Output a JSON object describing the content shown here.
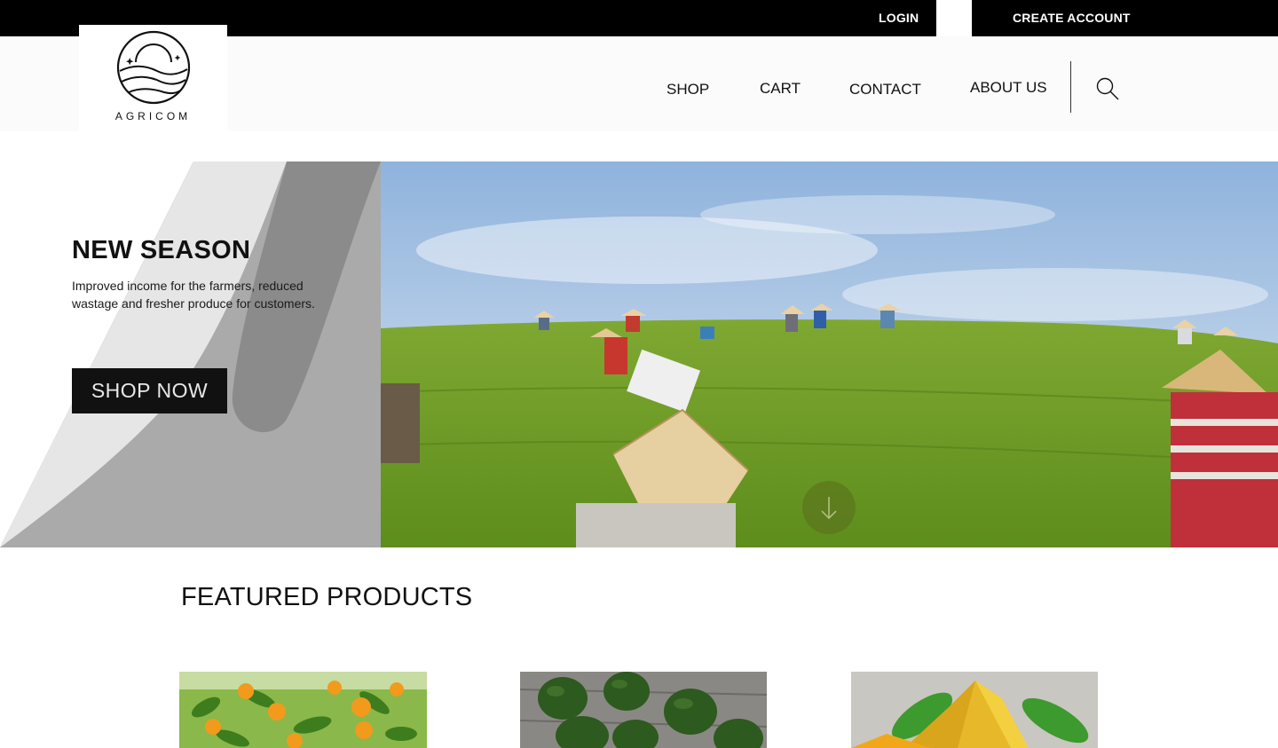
{
  "topbar": {
    "login_label": "LOGIN",
    "create_account_label": "CREATE ACCOUNT"
  },
  "brand": {
    "name": "AGRICOM"
  },
  "nav": {
    "items": [
      {
        "label": "SHOP"
      },
      {
        "label": "CART"
      },
      {
        "label": "CONTACT"
      },
      {
        "label": "ABOUT US"
      }
    ],
    "search_icon": "search-icon"
  },
  "hero": {
    "title": "NEW SEASON",
    "subtitle": "Improved income for the farmers, reduced wastage and fresher produce for customers.",
    "cta_label": "SHOP NOW",
    "scroll_icon": "arrow-down-icon"
  },
  "featured": {
    "title": "FEATURED PRODUCTS"
  },
  "colors": {
    "topbar": "#000000",
    "button": "#111111",
    "panel_gray": "#8a8b8a",
    "panel_light": "#e6e6e6"
  }
}
